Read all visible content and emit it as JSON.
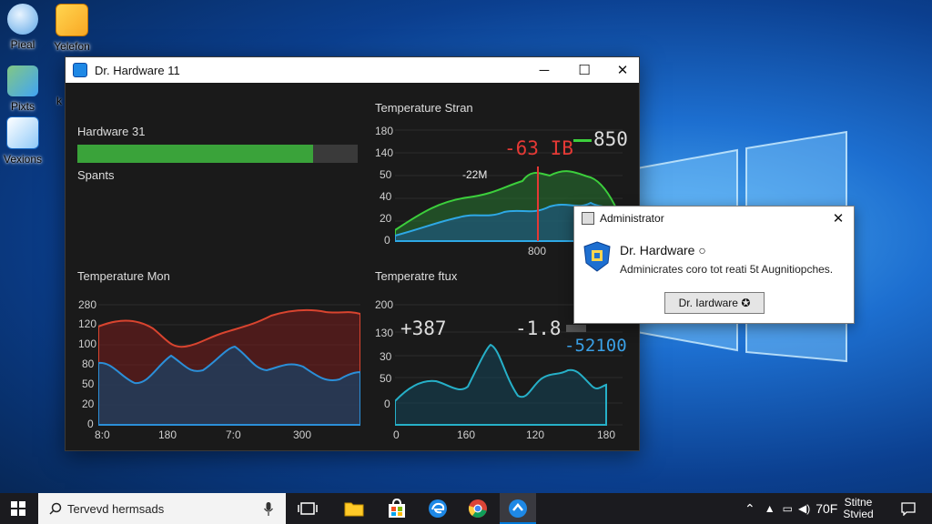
{
  "desktop": {
    "icons": [
      {
        "label": "Pieal",
        "icon": "recycle-bin-icon"
      },
      {
        "label": "Yelefon",
        "icon": "folder-icon"
      },
      {
        "label": "Pixts",
        "icon": "pictures-icon"
      },
      {
        "label": "Vexions",
        "icon": "document-icon"
      }
    ],
    "side_label": "k"
  },
  "window": {
    "title": "Dr. Hardware 11",
    "controls": {
      "minimize": "─",
      "maximize": "☐",
      "close": "✕"
    },
    "hardware": {
      "label": "Hardware 31",
      "progress_fraction": 0.84,
      "sub_label": "Spants"
    },
    "temp_strain": {
      "title": "Temperature Stran",
      "y_ticks": [
        "180",
        "140",
        "50",
        "40",
        "20",
        "0"
      ],
      "x_tick": "800",
      "readout_red": "-63 IB",
      "readout_green": "850",
      "annotation": "-22M"
    },
    "temp_mon": {
      "title": "Temperature Mon",
      "y_ticks": [
        "280",
        "120",
        "100",
        "80",
        "50",
        "20",
        "0"
      ],
      "x_ticks": [
        "8:0",
        "180",
        "7:0",
        "300"
      ]
    },
    "temp_flux": {
      "title": "Temperatre ftux",
      "y_ticks": [
        "200",
        "130",
        "30",
        "50",
        "0"
      ],
      "x_ticks": [
        "0",
        "160",
        "120",
        "180"
      ],
      "readout_left": "+387",
      "readout_mid": "-1.8",
      "readout_right": "-52100"
    }
  },
  "dialog": {
    "title": "Administrator",
    "heading": "Dr. Hardware ○",
    "message": "Adminicrates coro tot reati 5t Augnitiopches.",
    "button": "Dr. Iardware ✪",
    "close": "✕"
  },
  "taskbar": {
    "search_placeholder": "Tervevd hermsads",
    "clock_line1": "Stitne",
    "clock_line2": "Stvied",
    "tray_text": "70F",
    "accent": "#0078d7"
  }
}
